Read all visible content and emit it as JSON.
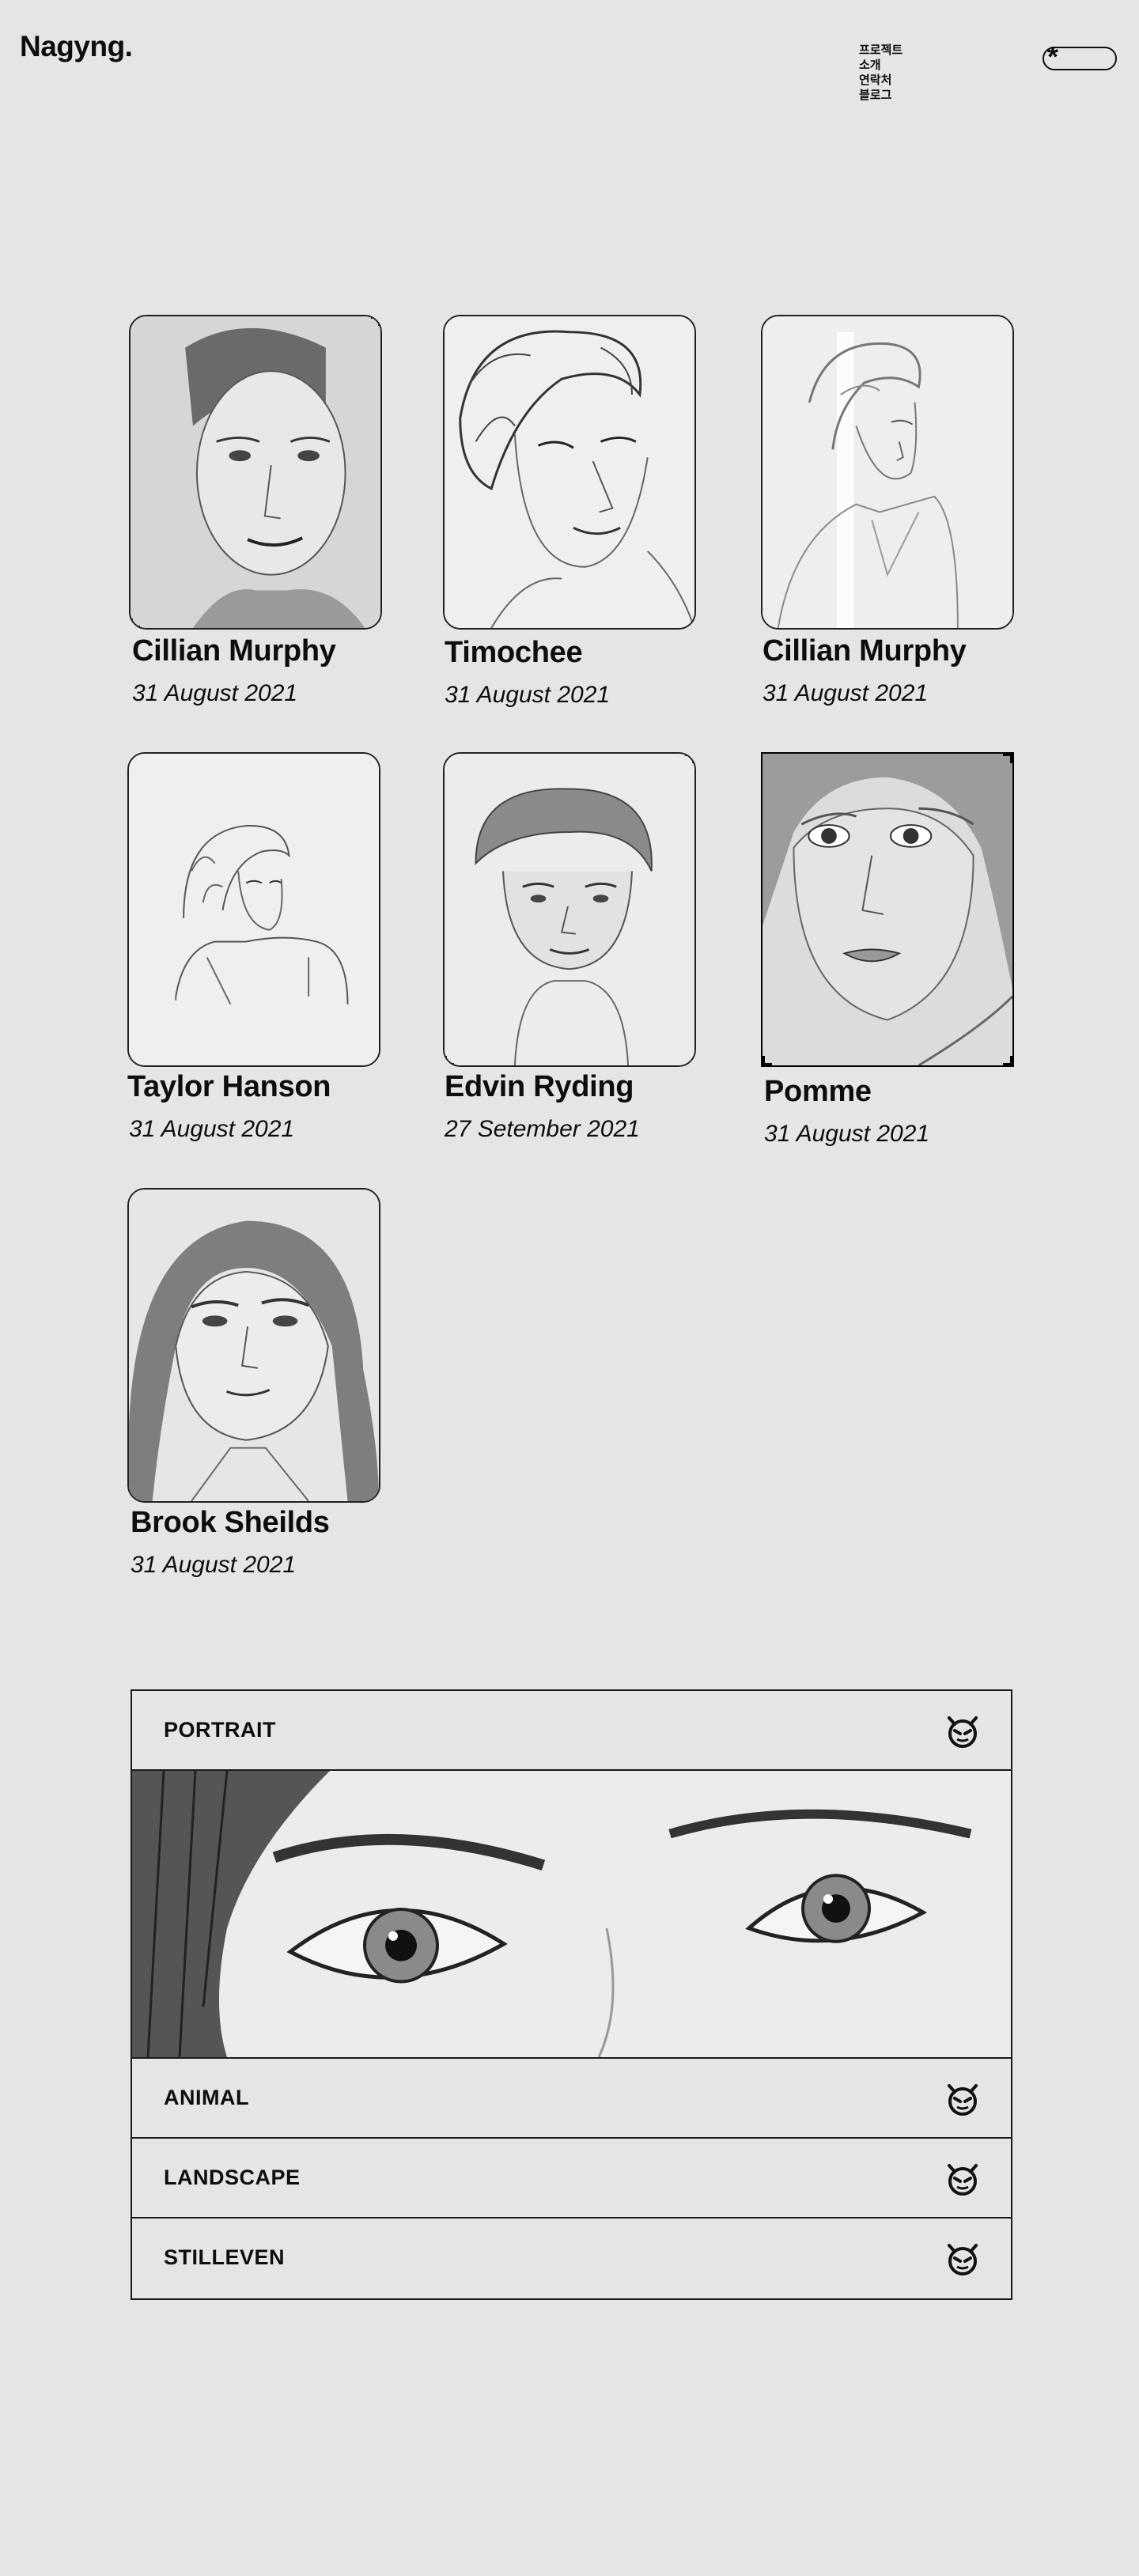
{
  "brand": {
    "logo": "Nagyng."
  },
  "nav": {
    "items": [
      "프로젝트",
      "소개",
      "연락처",
      "블로그"
    ]
  },
  "theme_toggle": {
    "symbol": "*"
  },
  "gallery": [
    {
      "name": "Cillian Murphy",
      "date": "31 August 2021"
    },
    {
      "name": "Timochee",
      "date": "31 August 2021"
    },
    {
      "name": "Cillian Murphy",
      "date": "31 August 2021"
    },
    {
      "name": "Taylor Hanson",
      "date": "31 August 2021"
    },
    {
      "name": "Edvin Ryding",
      "date": "27 Setember 2021"
    },
    {
      "name": "Pomme",
      "date": "31 August 2021"
    },
    {
      "name": "Brook Sheilds",
      "date": "31 August 2021"
    }
  ],
  "categories": [
    {
      "label": "PORTRAIT",
      "expanded": true
    },
    {
      "label": "ANIMAL",
      "expanded": false
    },
    {
      "label": "LANDSCAPE",
      "expanded": false
    },
    {
      "label": "STILLEVEN",
      "expanded": false
    }
  ],
  "category_icon": "demon-face-icon"
}
